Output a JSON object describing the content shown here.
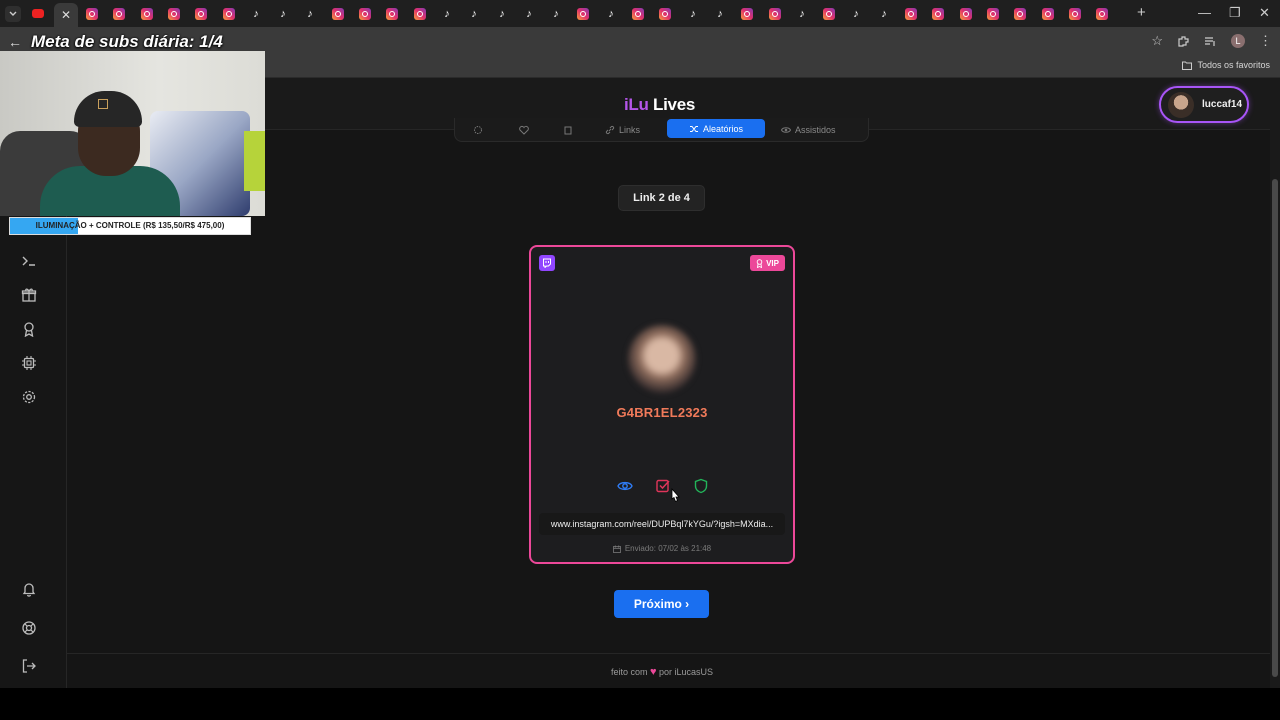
{
  "browser": {
    "tab_favicons": [
      "instagram",
      "instagram",
      "instagram",
      "instagram",
      "instagram",
      "instagram",
      "tiktok",
      "tiktok",
      "tiktok",
      "instagram",
      "instagram",
      "instagram",
      "instagram",
      "tiktok",
      "tiktok",
      "tiktok",
      "tiktok",
      "tiktok",
      "instagram",
      "tiktok",
      "instagram",
      "instagram",
      "tiktok",
      "tiktok",
      "instagram",
      "instagram",
      "tiktok",
      "instagram",
      "tiktok",
      "tiktok",
      "instagram",
      "instagram",
      "instagram",
      "instagram",
      "instagram",
      "instagram",
      "instagram",
      "instagram"
    ],
    "bookmarks_all_label": "Todos os favoritos",
    "profile_initial": "L"
  },
  "app": {
    "brand_left": "iLu",
    "brand_right": "Lives",
    "user_name": "luccaf14"
  },
  "tabs": [
    {
      "label": "",
      "icon": "gear-icon"
    },
    {
      "label": "",
      "icon": "heart-icon"
    },
    {
      "label": "",
      "icon": "clipboard-icon"
    },
    {
      "label": "Links",
      "icon": "link-icon"
    },
    {
      "label": "Aleatórios",
      "icon": "shuffle-icon",
      "active": true
    },
    {
      "label": "Assistidos",
      "icon": "eye-icon"
    }
  ],
  "link_counter": "Link 2 de 4",
  "card": {
    "platform": "twitch",
    "badge": "VIP",
    "username": "G4BR1EL2323",
    "url": "www.instagram.com/reel/DUPBql7kYGu/?igsh=MXdia...",
    "sent_at": "Enviado: 07/02 às 21:48",
    "accent_color": "#ec4899"
  },
  "next_button": "Próximo ›",
  "footer": {
    "prefix": "feito com",
    "suffix": "por iLucasUS"
  },
  "overlay": {
    "title": "Meta de subs diária: 1/4",
    "goal_text": "ILUMINAÇÃO + CONTROLE (R$ 135,50/R$ 475,00)",
    "goal_progress": 0.285
  },
  "colors": {
    "primary": "#1a6ff0",
    "brand_purple": "#b455e8",
    "username": "#f07a5a",
    "twitch": "#9146ff"
  }
}
